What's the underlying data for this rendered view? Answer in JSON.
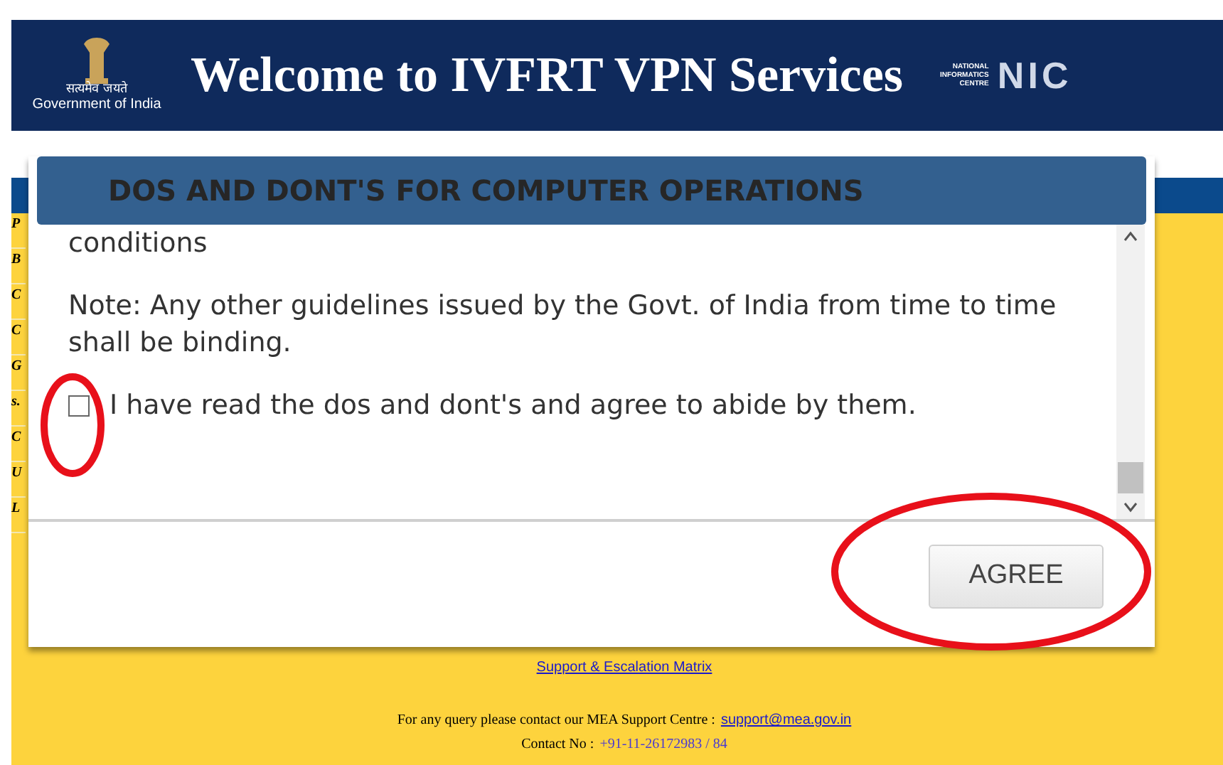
{
  "header": {
    "emblem_caption": "सत्यमेव जयते",
    "government": "Government of India",
    "title": "Welcome to IVFRT VPN Services",
    "nic_small": [
      "NATIONAL",
      "INFORMATICS",
      "CENTRE"
    ],
    "nic": "NIC"
  },
  "side_letters": [
    "P",
    "B",
    "C",
    "C",
    "G",
    "s.",
    "C",
    "U",
    "L"
  ],
  "footer": {
    "link": "Support & Escalation Matrix",
    "query": "For any query please contact our MEA Support Centre :",
    "email": "support@mea.gov.in",
    "contact_label": "Contact No :",
    "contact_number": "+91-11-26172983 / 84"
  },
  "dialog": {
    "title": "DOS AND DONT'S FOR COMPUTER OPERATIONS",
    "paragraphs": [
      "conditions",
      "Note: Any other guidelines issued by the Govt. of India from time to time shall be binding."
    ],
    "agreement": {
      "label": "I have read the dos and dont's and agree to abide by them.",
      "checked": false
    },
    "button": "AGREE"
  }
}
